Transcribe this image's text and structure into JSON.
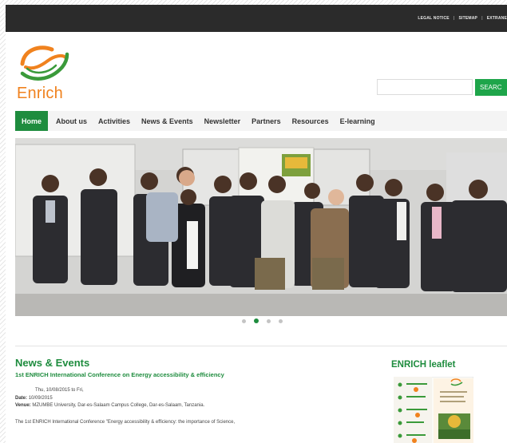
{
  "topbar": {
    "links": [
      "LEGAL NOTICE",
      "SITEMAP",
      "EXTRANE"
    ]
  },
  "brand": {
    "name": "Enrich",
    "colors": {
      "orange": "#f0821e",
      "green": "#3a9a3a"
    }
  },
  "search": {
    "value": "",
    "placeholder": "",
    "button_label": "SEARC"
  },
  "nav": {
    "items": [
      {
        "label": "Home",
        "active": true
      },
      {
        "label": "About us"
      },
      {
        "label": "Activities"
      },
      {
        "label": "News & Events"
      },
      {
        "label": "Newsletter"
      },
      {
        "label": "Partners"
      },
      {
        "label": "Resources"
      },
      {
        "label": "E-learning"
      }
    ]
  },
  "slider": {
    "slide_count": 4,
    "active_index": 1
  },
  "news": {
    "heading": "News & Events",
    "article": {
      "title": "1st ENRICH International Conference on Energy accessibility & efficiency",
      "date_range": "Thu, 10/08/2015 to Fri,",
      "date_label": "Date:",
      "date_value": "10/09/2015",
      "venue_label": "Venue:",
      "venue_value": "MZUMBE University, Dar-es-Salaam Campus College, Dar-es-Salaam, Tanzania.",
      "body": "The 1st ENRICH International Conference \"Energy accessibility & efficiency: the importance of Science,"
    }
  },
  "sidebar": {
    "leaflet_heading": "ENRICH leaflet"
  },
  "colors": {
    "accent_green": "#1e8c3e",
    "search_green": "#1ea54a",
    "topbar": "#2b2b2b"
  }
}
